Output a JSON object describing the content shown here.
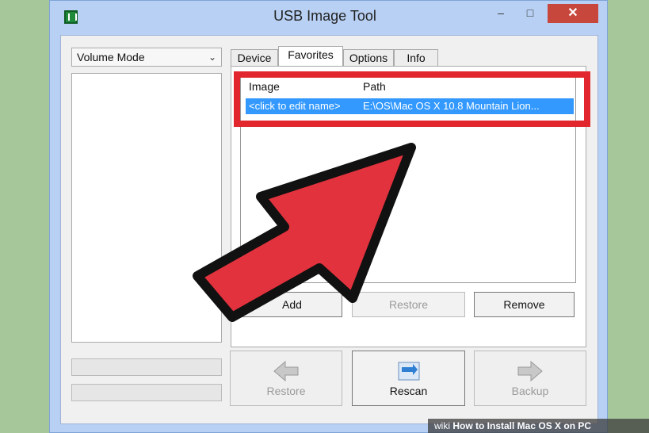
{
  "window": {
    "title": "USB Image Tool"
  },
  "left": {
    "mode_select": "Volume Mode"
  },
  "tabs": [
    "Device",
    "Favorites",
    "Options",
    "Info"
  ],
  "active_tab": "Favorites",
  "favorites": {
    "columns": [
      "Image",
      "Path"
    ],
    "rows": [
      {
        "name": "<click to edit name>",
        "path": "E:\\OS\\Mac OS X 10.8 Mountain Lion..."
      }
    ]
  },
  "panel_buttons": {
    "add": "Add",
    "restore": "Restore",
    "remove": "Remove"
  },
  "bottom_buttons": {
    "restore": "Restore",
    "rescan": "Rescan",
    "backup": "Backup"
  },
  "overlay": {
    "wiki_text": "wiki",
    "watermark": "How to Install Mac OS X on PC"
  },
  "colors": {
    "highlight": "#e1262e",
    "arrow": "#e2323d",
    "selection": "#3399ff"
  }
}
